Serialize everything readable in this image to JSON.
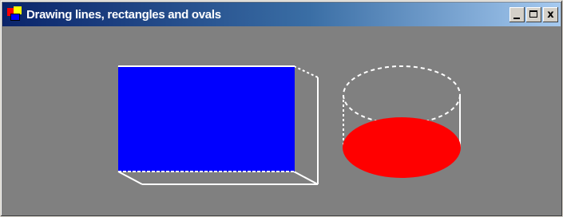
{
  "window": {
    "title": "Drawing lines, rectangles and ovals",
    "controls": {
      "minimize_icon": "minimize-icon",
      "maximize_icon": "maximize-icon",
      "close_label": "x"
    }
  },
  "colors": {
    "client_background": "#808080",
    "rectangle_fill": "#0000ff",
    "oval_fill": "#ff0000",
    "outline": "#ffffff"
  },
  "shapes": [
    {
      "kind": "box-3d",
      "fill": "blue rectangle with white outline edges"
    },
    {
      "kind": "cylinder",
      "fill": "red filled oval base with white dashed oval top"
    }
  ]
}
